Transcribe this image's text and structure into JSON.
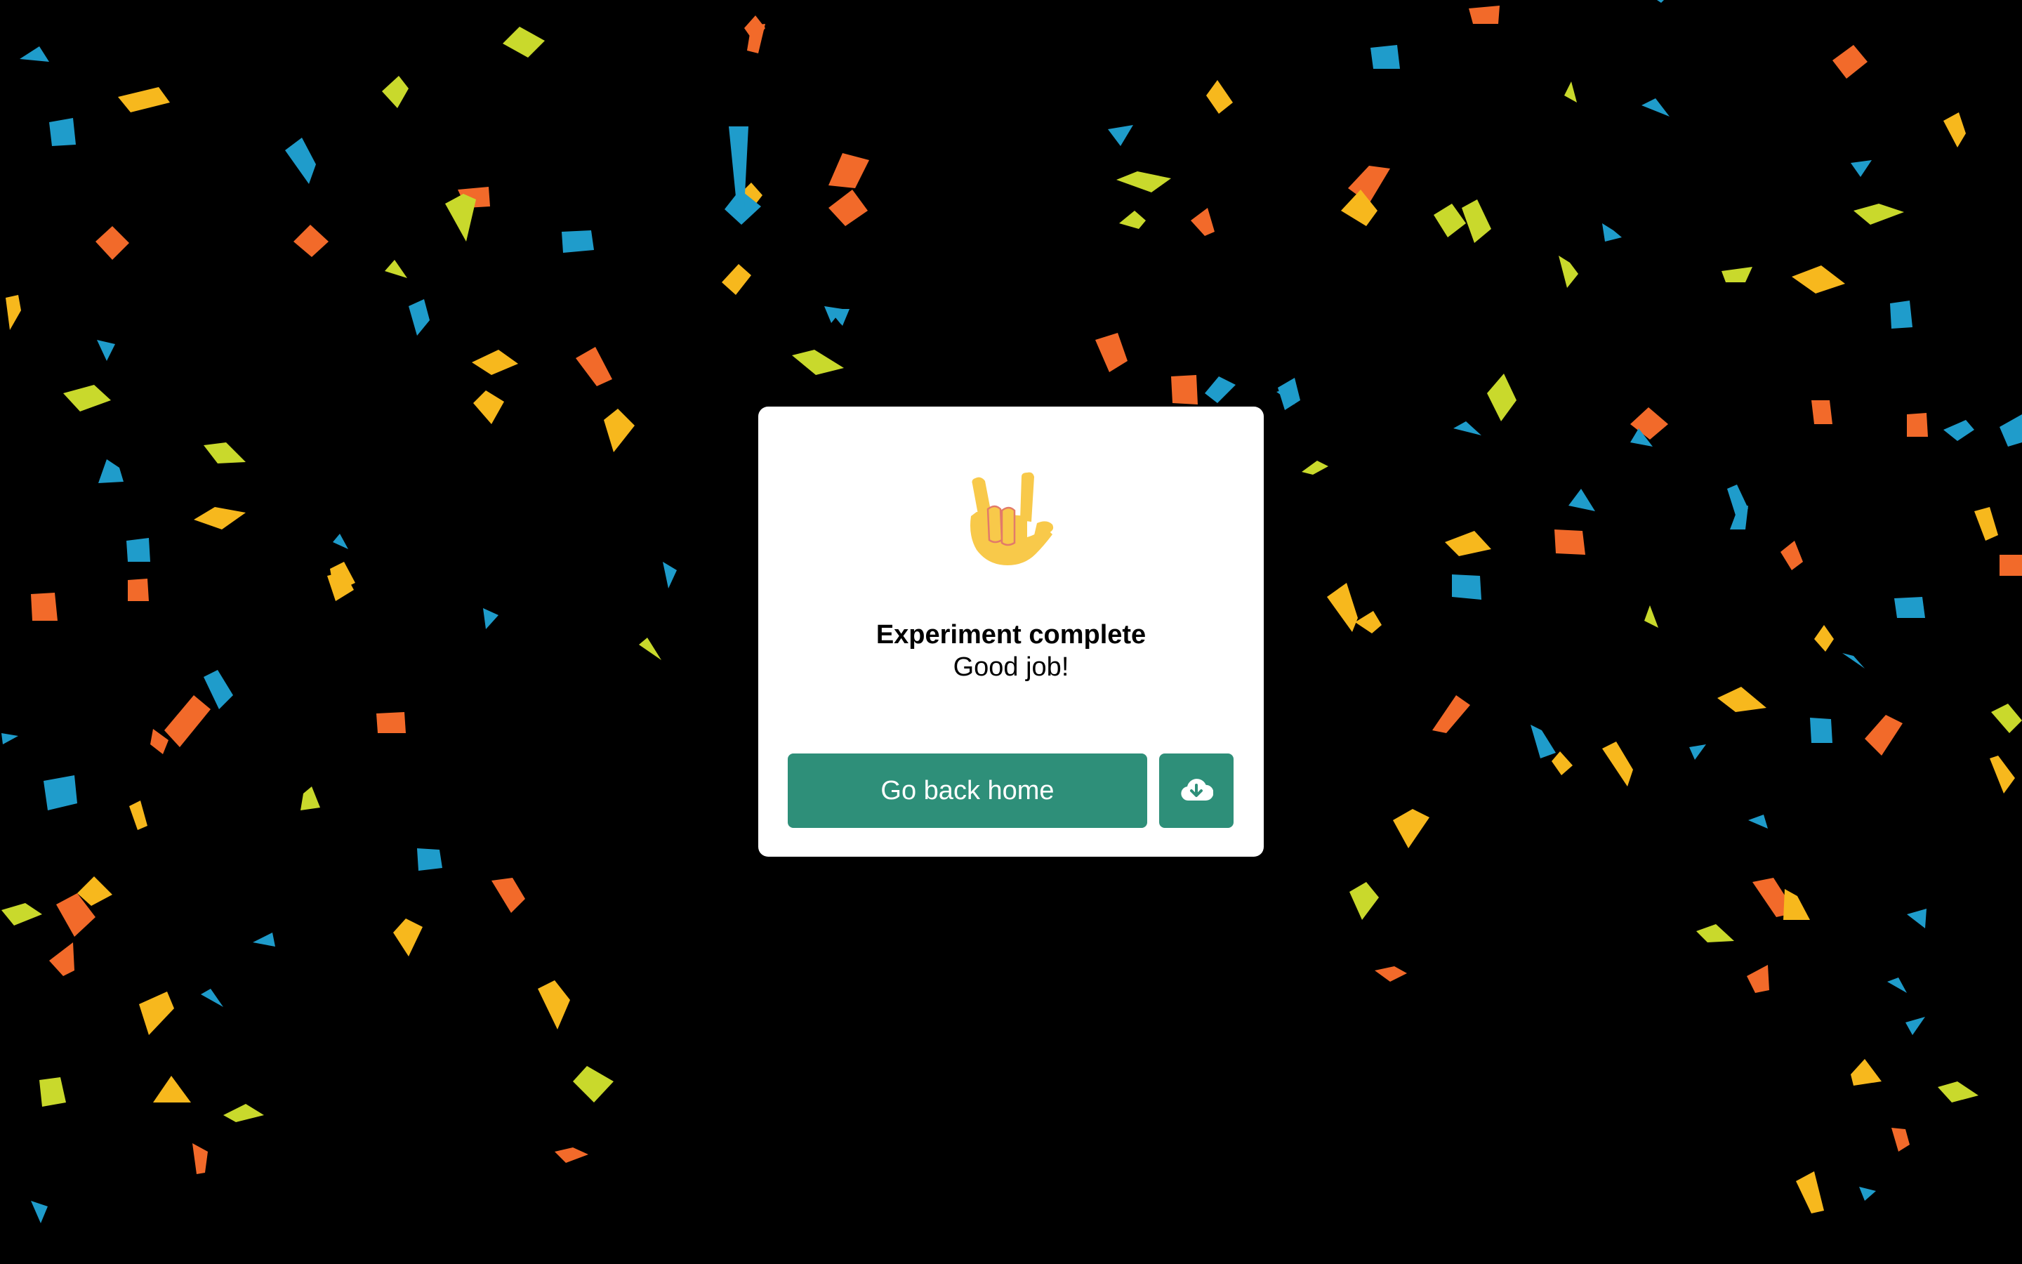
{
  "dialog": {
    "title": "Experiment complete",
    "subtitle": "Good job!",
    "home_button_label": "Go back home",
    "download_button_icon": "cloud-download-icon",
    "emoji_icon": "love-you-gesture-icon"
  },
  "colors": {
    "background": "#000000",
    "dialog": "#ffffff",
    "accent": "#2e8f79",
    "confetti": [
      "#f26a2a",
      "#f7b81d",
      "#c9d92c",
      "#1f9ccb"
    ]
  }
}
